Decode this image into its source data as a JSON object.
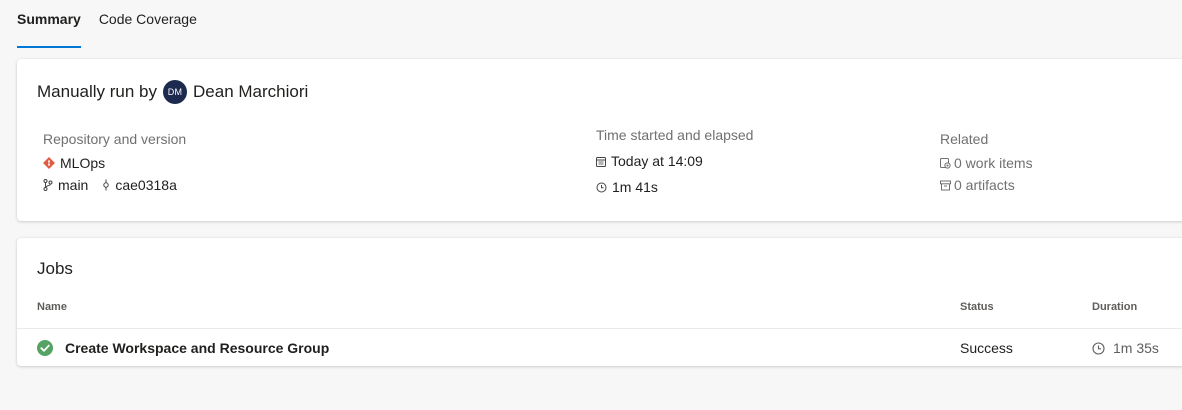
{
  "tabs": [
    {
      "label": "Summary",
      "active": true
    },
    {
      "label": "Code Coverage",
      "active": false
    }
  ],
  "run": {
    "title_prefix": "Manually run by",
    "avatar_initials": "DM",
    "user": "Dean Marchiori"
  },
  "repository": {
    "heading": "Repository and version",
    "name": "MLOps",
    "branch": "main",
    "commit": "cae0318a"
  },
  "time": {
    "heading": "Time started and elapsed",
    "started": "Today at 14:09",
    "elapsed": "1m 41s"
  },
  "related": {
    "heading": "Related",
    "work_items": "0 work items",
    "artifacts": "0 artifacts"
  },
  "jobs": {
    "title": "Jobs",
    "columns": {
      "name": "Name",
      "status": "Status",
      "duration": "Duration"
    },
    "rows": [
      {
        "name": "Create Workspace and Resource Group",
        "status": "Success",
        "duration": "1m 35s"
      }
    ]
  },
  "colors": {
    "accent": "#0078d4",
    "success": "#55a362",
    "repo_icon": "#e05d44",
    "avatar_bg": "#1b2a4e"
  }
}
